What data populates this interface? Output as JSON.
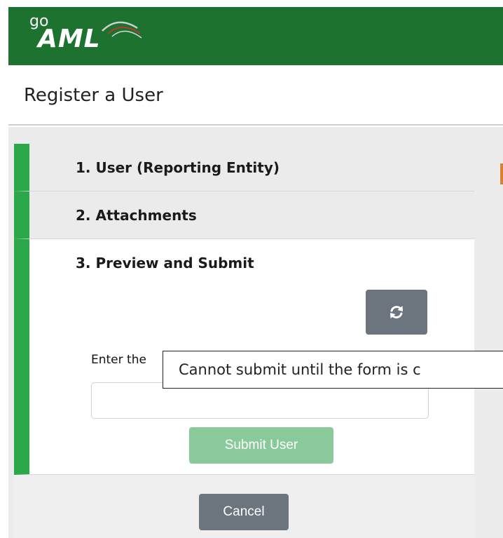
{
  "header": {
    "logo": {
      "prefix": "go",
      "name": "AML"
    },
    "background_color": "#1d722f"
  },
  "page": {
    "title": "Register a User"
  },
  "wizard": {
    "accent_color": "#2ba84a",
    "steps": [
      {
        "label": "1. User (Reporting Entity)"
      },
      {
        "label": "2. Attachments"
      },
      {
        "label": "3. Preview and Submit"
      }
    ],
    "refresh_icon": "refresh-icon",
    "captcha_label": "Enter the",
    "captcha_value": "",
    "submit_label": "Submit User"
  },
  "footer": {
    "cancel_label": "Cancel"
  },
  "tooltip": {
    "text": "Cannot submit until the form is c"
  }
}
